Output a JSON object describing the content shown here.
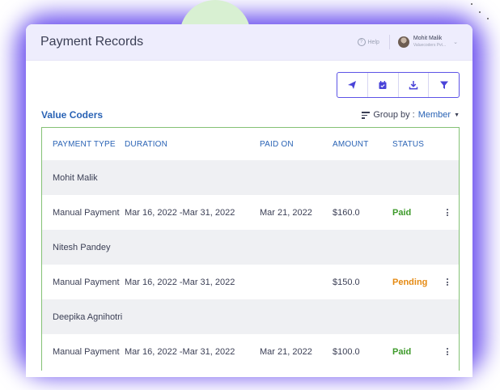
{
  "header": {
    "title": "Payment Records",
    "help_label": "Help"
  },
  "user": {
    "name": "Mohit Malik",
    "subtitle": "Valuecoders Pvt..."
  },
  "toolbar": {
    "icons": [
      "send-icon",
      "calendar-icon",
      "download-icon",
      "filter-icon"
    ]
  },
  "company": "Value Coders",
  "group_by": {
    "label": "Group by :",
    "value": "Member"
  },
  "columns": [
    "PAYMENT TYPE",
    "DURATION",
    "PAID ON",
    "AMOUNT",
    "STATUS"
  ],
  "groups": [
    {
      "member": "Mohit Malik",
      "payment_type": "Manual Payment",
      "duration": "Mar 16, 2022 -Mar 31, 2022",
      "paid_on": "Mar 21, 2022",
      "amount": "$160.0",
      "status": "Paid"
    },
    {
      "member": "Nitesh Pandey",
      "payment_type": "Manual Payment",
      "duration": "Mar 16, 2022 -Mar 31, 2022",
      "paid_on": "",
      "amount": "$150.0",
      "status": "Pending"
    },
    {
      "member": "Deepika Agnihotri",
      "payment_type": "Manual Payment",
      "duration": "Mar 16, 2022 -Mar 31, 2022",
      "paid_on": "Mar 21, 2022",
      "amount": "$100.0",
      "status": "Paid"
    }
  ],
  "colors": {
    "accent": "#2a63b5",
    "paid": "#3d9a2a",
    "pending": "#e58a12",
    "border": "#84c175",
    "glow": "#6b50ee"
  }
}
